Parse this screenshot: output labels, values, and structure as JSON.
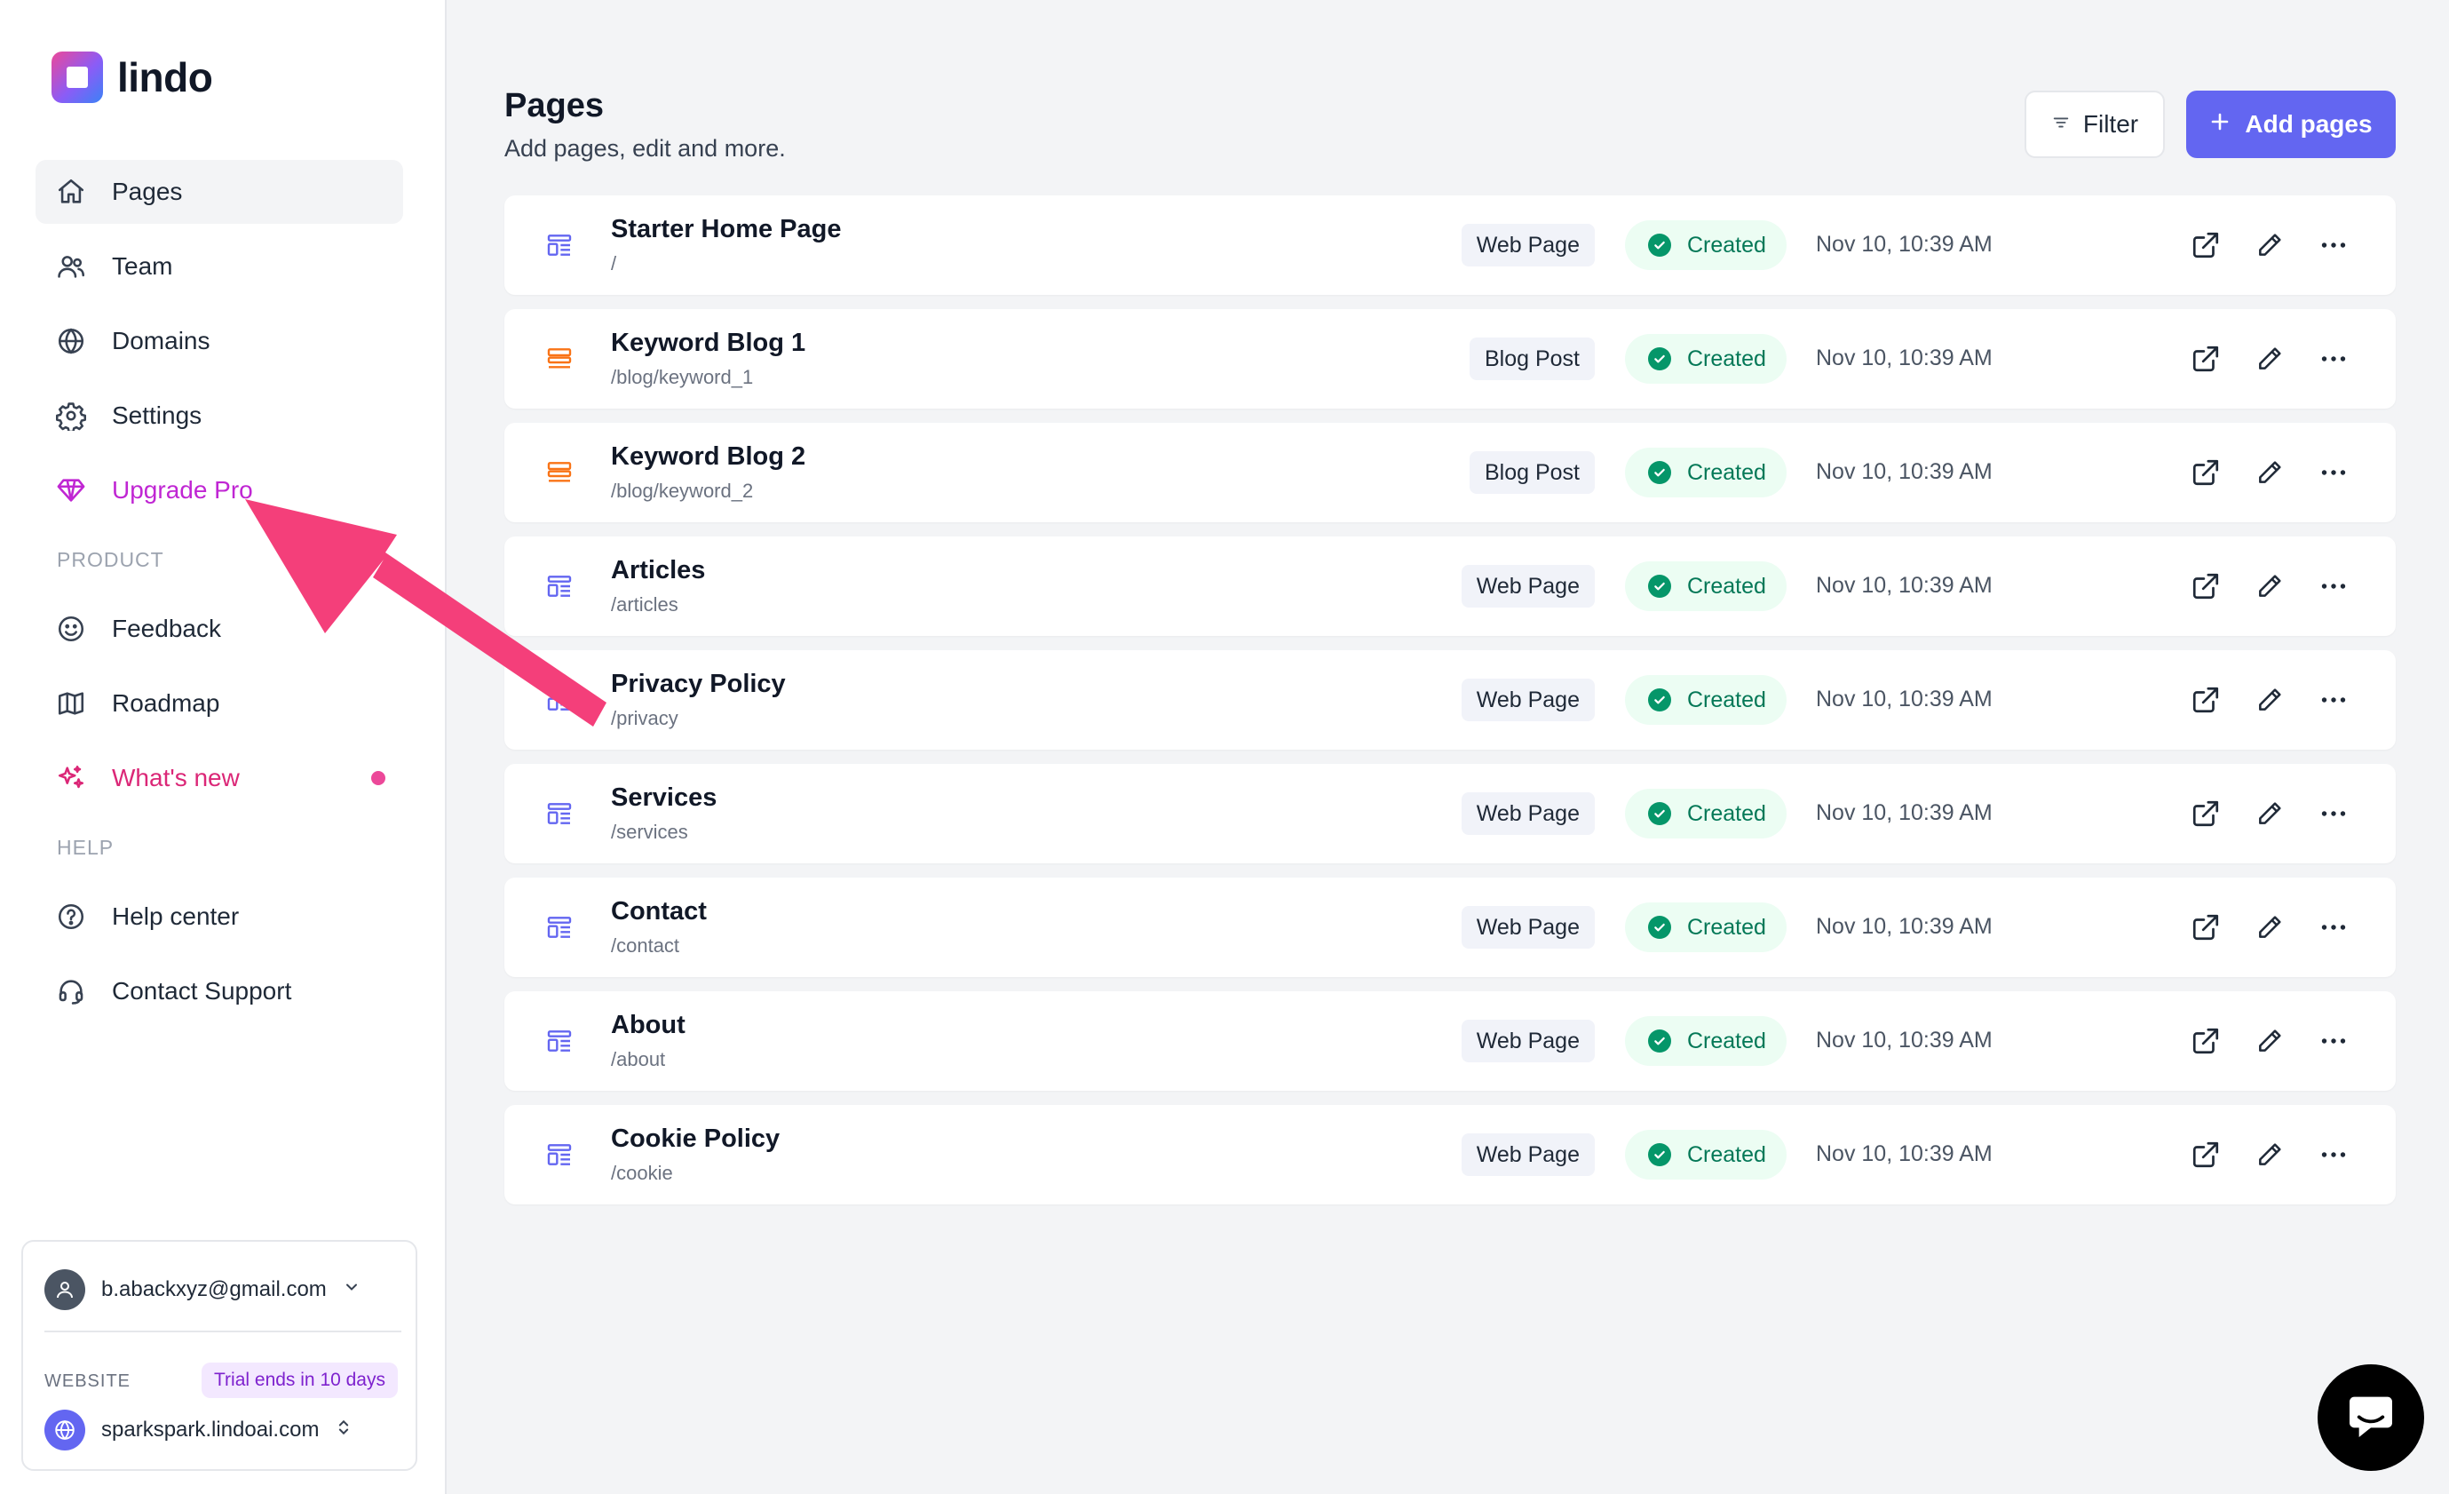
{
  "app": {
    "logo_text": "lindo"
  },
  "sidebar": {
    "nav": [
      {
        "label": "Pages",
        "icon": "home-icon",
        "active": true
      },
      {
        "label": "Team",
        "icon": "users-icon"
      },
      {
        "label": "Domains",
        "icon": "globe-icon"
      },
      {
        "label": "Settings",
        "icon": "gear-icon"
      },
      {
        "label": "Upgrade Pro",
        "icon": "diamond-icon",
        "accent": "#c026d3"
      }
    ],
    "product_section": "PRODUCT",
    "product": [
      {
        "label": "Feedback",
        "icon": "smile-icon"
      },
      {
        "label": "Roadmap",
        "icon": "map-icon"
      },
      {
        "label": "What's new",
        "icon": "sparkles-icon",
        "accent": "#db2777"
      }
    ],
    "help_section": "HELP",
    "help": [
      {
        "label": "Help center",
        "icon": "question-icon"
      },
      {
        "label": "Contact Support",
        "icon": "headset-icon"
      }
    ],
    "account": {
      "email": "b.abackxyz@gmail.com",
      "website_label": "WEBSITE",
      "trial_badge": "Trial ends in 10 days",
      "site": "sparkspark.lindoai.com"
    }
  },
  "header": {
    "title": "Pages",
    "subtitle": "Add pages, edit and more.",
    "filter_label": "Filter",
    "add_label": "Add pages"
  },
  "pages": [
    {
      "title": "Starter Home Page",
      "path": "/",
      "type": "Web Page",
      "status": "Created",
      "date": "Nov 10, 10:39 AM",
      "icon": "webpage-icon"
    },
    {
      "title": "Keyword Blog 1",
      "path": "/blog/keyword_1",
      "type": "Blog Post",
      "status": "Created",
      "date": "Nov 10, 10:39 AM",
      "icon": "blogpost-icon"
    },
    {
      "title": "Keyword Blog 2",
      "path": "/blog/keyword_2",
      "type": "Blog Post",
      "status": "Created",
      "date": "Nov 10, 10:39 AM",
      "icon": "blogpost-icon"
    },
    {
      "title": "Articles",
      "path": "/articles",
      "type": "Web Page",
      "status": "Created",
      "date": "Nov 10, 10:39 AM",
      "icon": "webpage-icon"
    },
    {
      "title": "Privacy Policy",
      "path": "/privacy",
      "type": "Web Page",
      "status": "Created",
      "date": "Nov 10, 10:39 AM",
      "icon": "webpage-icon"
    },
    {
      "title": "Services",
      "path": "/services",
      "type": "Web Page",
      "status": "Created",
      "date": "Nov 10, 10:39 AM",
      "icon": "webpage-icon"
    },
    {
      "title": "Contact",
      "path": "/contact",
      "type": "Web Page",
      "status": "Created",
      "date": "Nov 10, 10:39 AM",
      "icon": "webpage-icon"
    },
    {
      "title": "About",
      "path": "/about",
      "type": "Web Page",
      "status": "Created",
      "date": "Nov 10, 10:39 AM",
      "icon": "webpage-icon"
    },
    {
      "title": "Cookie Policy",
      "path": "/cookie",
      "type": "Web Page",
      "status": "Created",
      "date": "Nov 10, 10:39 AM",
      "icon": "webpage-icon"
    }
  ],
  "colors": {
    "accent": "#6366f1",
    "success": "#059669",
    "annotation_arrow": "#f43f7a",
    "pink": "#db2777"
  }
}
